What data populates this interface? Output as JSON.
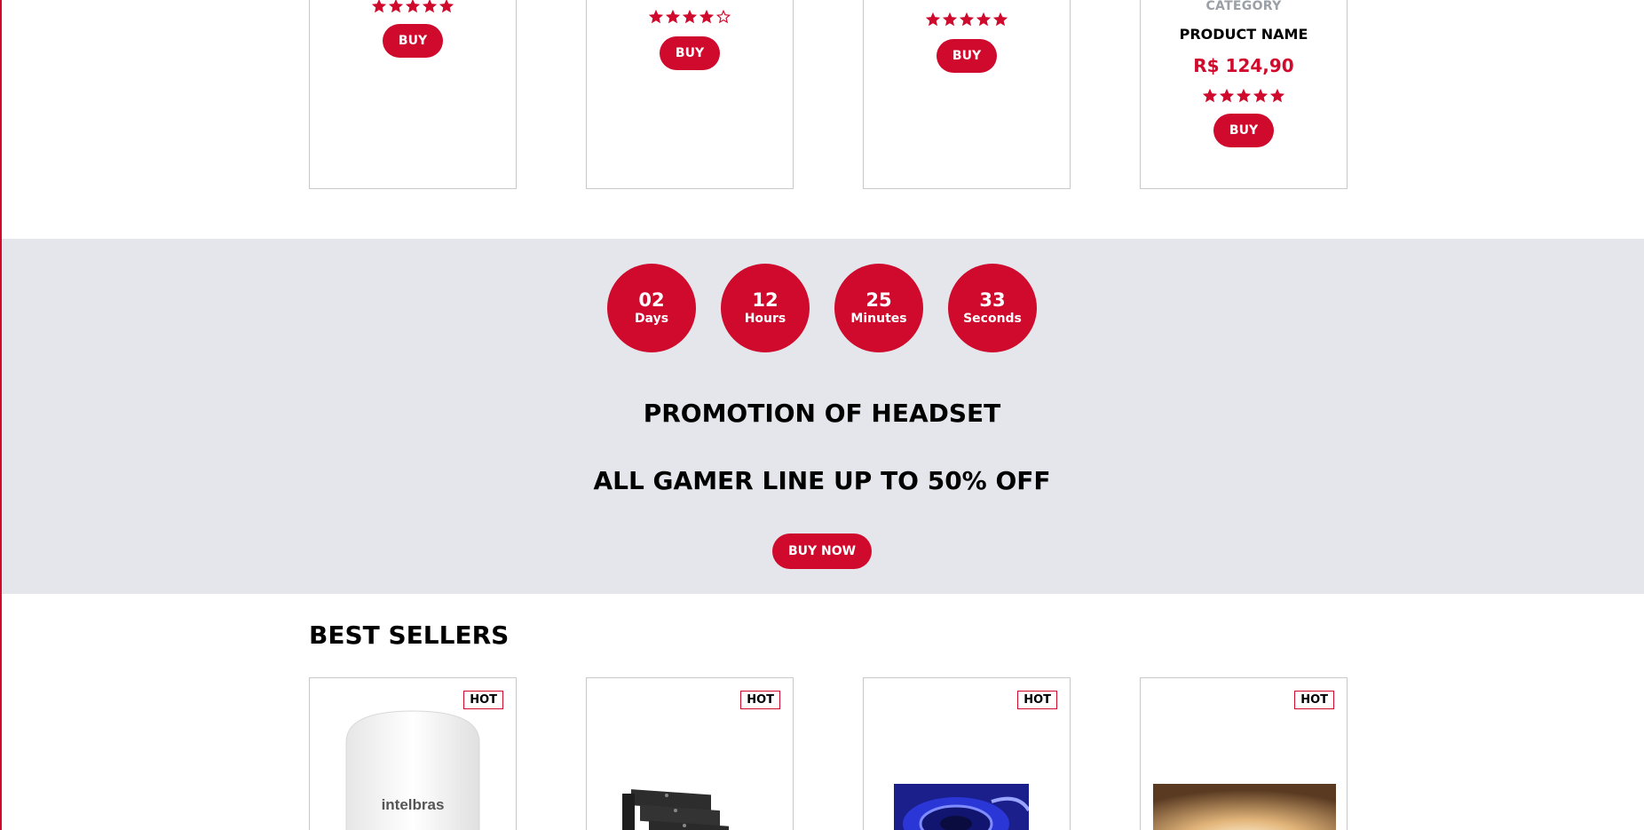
{
  "colors": {
    "accent": "#cf0a2c",
    "band": "#e4e6ec",
    "border": "#c9c9c9",
    "muted": "#9aa0a6"
  },
  "top_products": [
    {
      "rating": 5,
      "buy_label": "BUY"
    },
    {
      "rating": 4,
      "buy_label": "BUY"
    },
    {
      "rating": 5,
      "buy_label": "BUY"
    },
    {
      "category": "CATEGORY",
      "name": "PRODUCT NAME",
      "price": "R$ 124,90",
      "rating": 5,
      "buy_label": "BUY"
    }
  ],
  "countdown": [
    {
      "value": "02",
      "unit": "Days"
    },
    {
      "value": "12",
      "unit": "Hours"
    },
    {
      "value": "25",
      "unit": "Minutes"
    },
    {
      "value": "33",
      "unit": "Seconds"
    }
  ],
  "promo": {
    "title": "PROMOTION OF HEADSET",
    "subtitle": "ALL GAMER LINE UP TO 50% OFF",
    "cta": "BUY NOW"
  },
  "best_sellers": {
    "title": "BEST SELLERS",
    "items": [
      {
        "badge": "HOT",
        "image": "intelbras-access-point",
        "brand_text": "intelbras"
      },
      {
        "badge": "HOT",
        "image": "stacked-hardware-brackets"
      },
      {
        "badge": "HOT",
        "image": "blue-led-strip-reel"
      },
      {
        "badge": "HOT",
        "image": "warm-light-fixture"
      }
    ]
  }
}
